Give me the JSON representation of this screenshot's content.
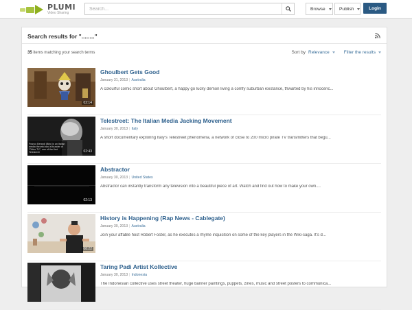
{
  "header": {
    "logo_title": "PLUMI",
    "logo_sub": "Video Sharing",
    "search_placeholder": "Search...",
    "browse_label": "Browse",
    "publish_label": "Publish",
    "login_label": "Login"
  },
  "panel": {
    "title": "Search results for \"........\"",
    "count": "35",
    "count_text": "items matching your search terms",
    "sort_label": "Sort by",
    "sort_value": "Relevance",
    "filter_label": "Filter the results"
  },
  "results": [
    {
      "title": "Ghoulbert Gets Good",
      "date": "January 31, 2013",
      "location": "Australia",
      "description": "A colourful comic short about Ghoulbert, a happy go lucky demon living a comfy suburban existance, thwarted by his innocenc...",
      "duration": "02:14"
    },
    {
      "title": "Telestreet: The Italian Media Jacking Movement",
      "date": "January 30, 2013",
      "location": "Italy",
      "description": "A short documentary exploring Italy's Telestreet phenomena, a network of close to 200 micro pirate TV transmitters that begu...",
      "duration": "02:43",
      "thumb_caption": "Franco Berardi (Bifo) is an Italian media theorist and a founder of \"Orfeo TV\", one of the first Telestreet"
    },
    {
      "title": "Abstractor",
      "date": "January 30, 2013",
      "location": "United States",
      "description": "Abstractor can instantly transform any television into a beautiful piece of art. Watch and find out how to make your own....",
      "duration": "02:13"
    },
    {
      "title": "History is Happening (Rap News - Cablegate)",
      "date": "January 30, 2013",
      "location": "Australia",
      "description": "Join your affable host Robert Foster, as he executes a rhyme inquisition on some of the key players in the Wiki-saga. It's d...",
      "duration": "08:22"
    },
    {
      "title": "Taring Padi Artist Kollective",
      "date": "January 30, 2013",
      "location": "Indonesia",
      "description": "The Indonesian collective uses street theater, huge banner paintings, puppets, zines, music and street posters to communica...",
      "duration": ""
    }
  ],
  "colors": {
    "accent": "#2c5f8c",
    "login": "#2b5a83",
    "logo_green": "#a6c23e"
  }
}
